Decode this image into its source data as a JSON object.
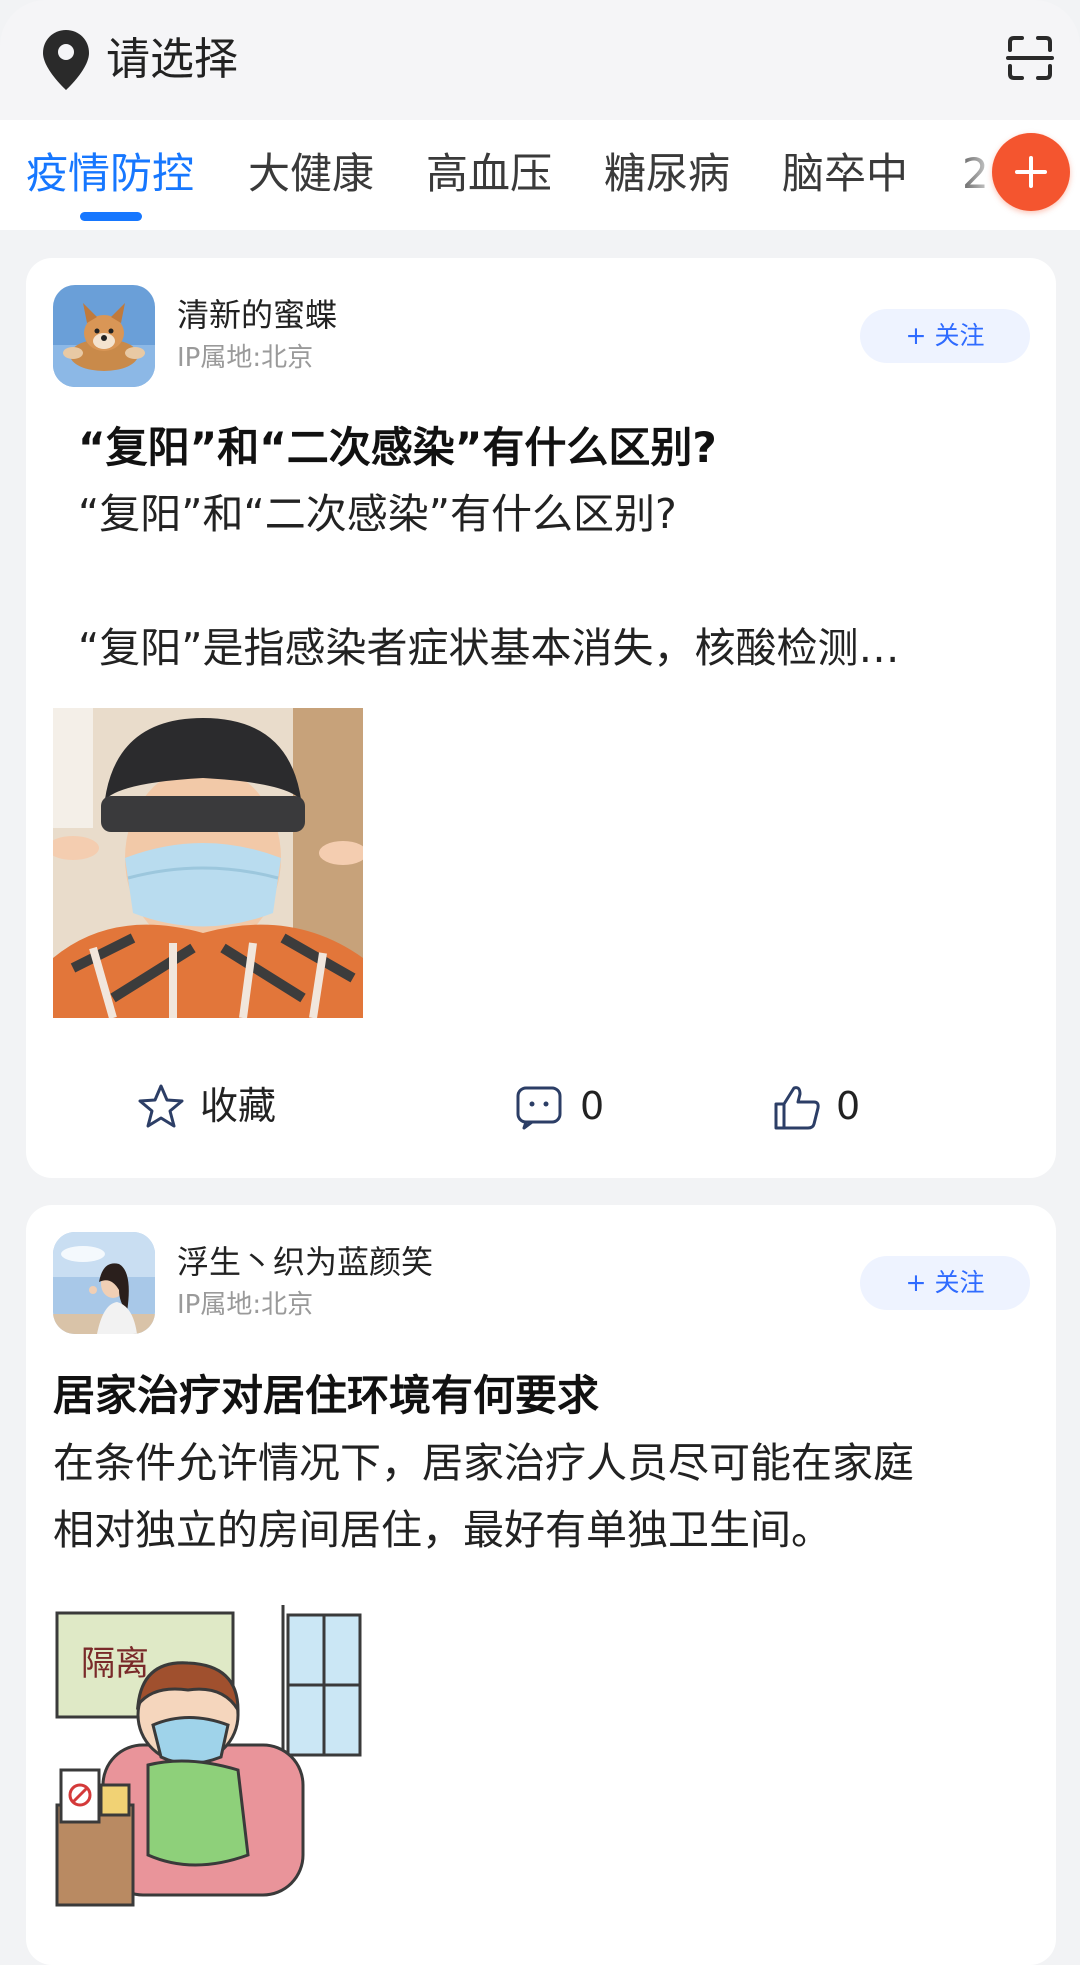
{
  "header": {
    "location_label": "请选择",
    "location_icon": "location-pin-icon",
    "scan_icon": "scan-icon"
  },
  "tabs": [
    {
      "label": "疫情防控",
      "active": true
    },
    {
      "label": "大健康",
      "active": false
    },
    {
      "label": "高血压",
      "active": false
    },
    {
      "label": "糖尿病",
      "active": false
    },
    {
      "label": "脑卒中",
      "active": false
    },
    {
      "label": "2",
      "active": false
    }
  ],
  "colors": {
    "accent": "#1677ff",
    "add_button": "#f4552f",
    "follow_text": "#2f6bff"
  },
  "posts": [
    {
      "author": "清新的蜜蝶",
      "ip_location": "IP属地:北京",
      "follow_label": "+ 关注",
      "title": "“复阳”和“二次感染”有什么区别?",
      "body_lines": [
        "“复阳”和“二次感染”有什么区别?",
        "",
        "“复阳”是指感染者症状基本消失，核酸检测…"
      ],
      "favorite_label": "收藏",
      "comment_count": "0",
      "like_count": "0"
    },
    {
      "author": "浮生丶织为蓝颜笑",
      "ip_location": "IP属地:北京",
      "follow_label": "+ 关注",
      "title": "居家治疗对居住环境有何要求",
      "body_lines": [
        "在条件允许情况下，居家治疗人员尽可能在家庭",
        "相对独立的房间居住，最好有单独卫生间。"
      ],
      "image_text": "隔离"
    }
  ]
}
